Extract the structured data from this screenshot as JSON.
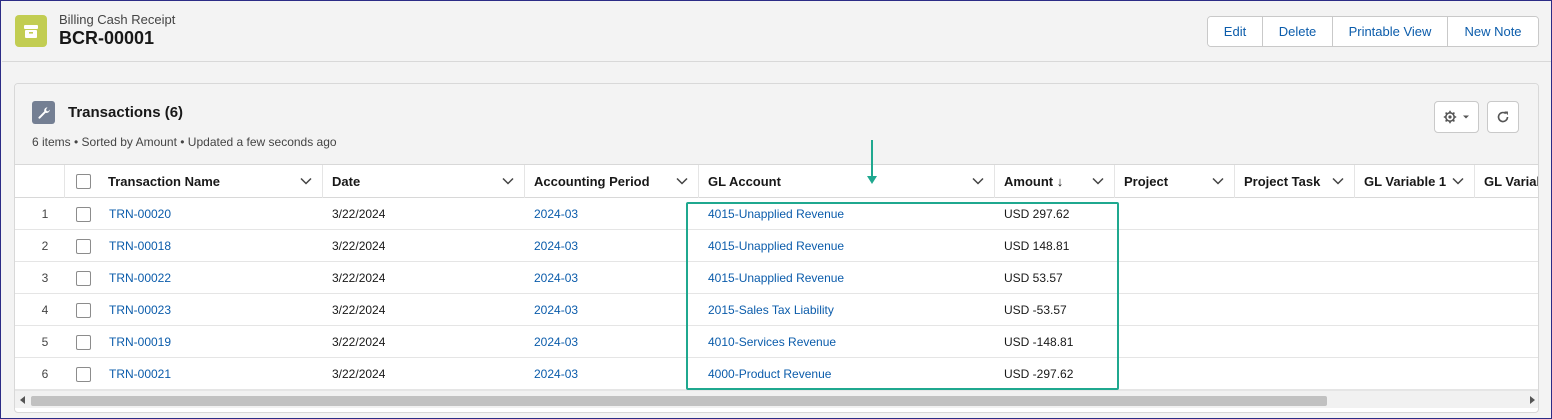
{
  "header": {
    "object_label": "Billing Cash Receipt",
    "record_name": "BCR-00001",
    "icon": "receipt-box-icon",
    "actions": [
      "Edit",
      "Delete",
      "Printable View",
      "New Note"
    ]
  },
  "related_list": {
    "title": "Transactions (6)",
    "meta": "6 items • Sorted by Amount • Updated a few seconds ago",
    "icon": "wrench-icon",
    "settings_icon": "gear-icon",
    "refresh_icon": "refresh-icon",
    "columns": [
      "Transaction Name",
      "Date",
      "Accounting Period",
      "GL Account",
      "Amount ↓",
      "Project",
      "Project Task",
      "GL Variable 1",
      "GL Variab"
    ],
    "rows": [
      {
        "num": "1",
        "name": "TRN-00020",
        "date": "3/22/2024",
        "period": "2024-03",
        "gl": "4015-Unapplied Revenue",
        "amount": "USD 297.62"
      },
      {
        "num": "2",
        "name": "TRN-00018",
        "date": "3/22/2024",
        "period": "2024-03",
        "gl": "4015-Unapplied Revenue",
        "amount": "USD 148.81"
      },
      {
        "num": "3",
        "name": "TRN-00022",
        "date": "3/22/2024",
        "period": "2024-03",
        "gl": "4015-Unapplied Revenue",
        "amount": "USD 53.57"
      },
      {
        "num": "4",
        "name": "TRN-00023",
        "date": "3/22/2024",
        "period": "2024-03",
        "gl": "2015-Sales Tax Liability",
        "amount": "USD -53.57"
      },
      {
        "num": "5",
        "name": "TRN-00019",
        "date": "3/22/2024",
        "period": "2024-03",
        "gl": "4010-Services Revenue",
        "amount": "USD -148.81"
      },
      {
        "num": "6",
        "name": "TRN-00021",
        "date": "3/22/2024",
        "period": "2024-03",
        "gl": "4000-Product Revenue",
        "amount": "USD -297.62"
      }
    ]
  },
  "colors": {
    "link": "#0b5cab",
    "highlight": "#1fa88f",
    "object_icon": "#c2cd52"
  }
}
